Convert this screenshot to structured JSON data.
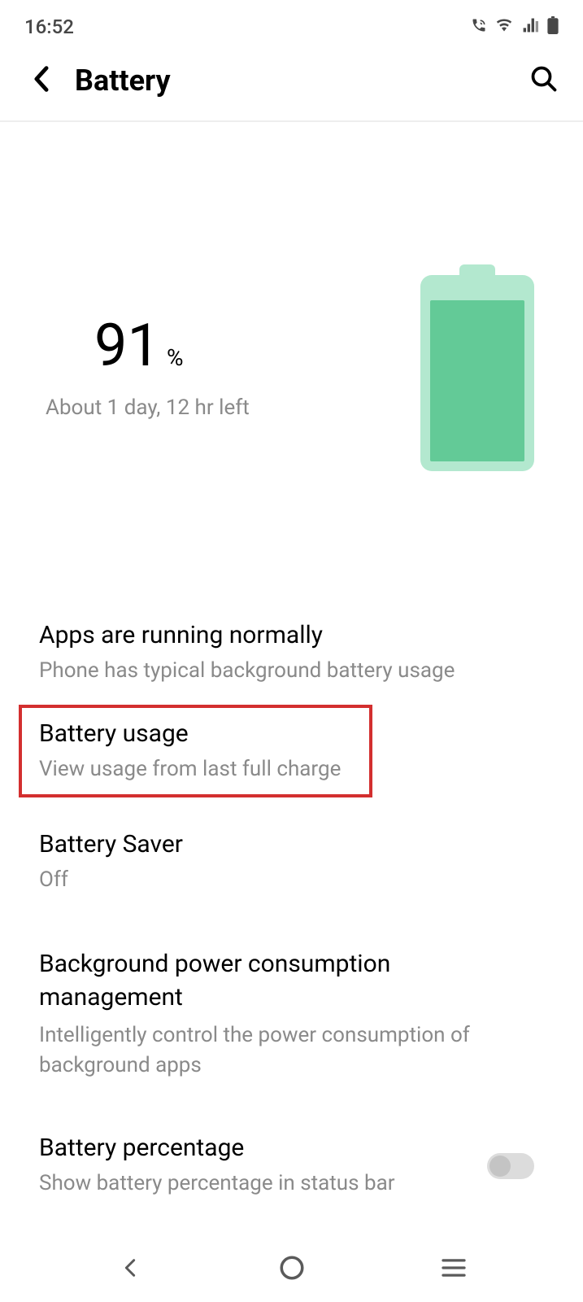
{
  "status_bar": {
    "time": "16:52"
  },
  "header": {
    "title": "Battery"
  },
  "summary": {
    "percent": "91",
    "percent_symbol": "%",
    "estimate": "About 1 day, 12 hr left",
    "fill_percent": 91
  },
  "items": [
    {
      "title": "Apps are running normally",
      "subtitle": "Phone has typical background battery usage"
    },
    {
      "title": "Battery usage",
      "subtitle": "View usage from last full charge"
    },
    {
      "title": "Battery Saver",
      "subtitle": "Off"
    },
    {
      "title": "Background power consumption management",
      "subtitle": "Intelligently control the power consumption of background apps"
    },
    {
      "title": "Battery percentage",
      "subtitle": "Show battery percentage in status bar"
    }
  ],
  "toggle_percentage_enabled": false
}
